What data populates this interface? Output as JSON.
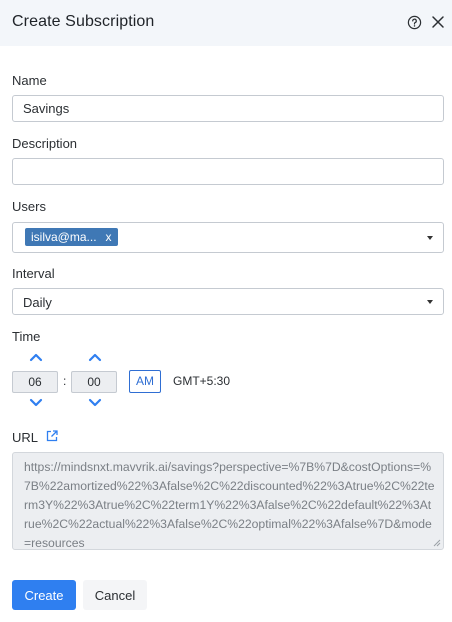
{
  "header": {
    "title": "Create Subscription",
    "help_icon": "help-circle-icon",
    "close_icon": "close-icon"
  },
  "form": {
    "name": {
      "label": "Name",
      "value": "Savings"
    },
    "description": {
      "label": "Description",
      "value": ""
    },
    "users": {
      "label": "Users",
      "chips": [
        "isilva@ma..."
      ],
      "chip_remove": "x"
    },
    "interval": {
      "label": "Interval",
      "value": "Daily"
    },
    "time": {
      "label": "Time",
      "hour": "06",
      "separator": ":",
      "minute": "00",
      "period": "AM",
      "timezone": "GMT+5:30"
    },
    "url": {
      "label": "URL",
      "value": "https://mindsnxt.mavvrik.ai/savings?perspective=%7B%7D&costOptions=%7B%22amortized%22%3Afalse%2C%22discounted%22%3Atrue%2C%22term3Y%22%3Atrue%2C%22term1Y%22%3Afalse%2C%22default%22%3Atrue%2C%22actual%22%3Afalse%2C%22optimal%22%3Afalse%7D&mode=resources"
    }
  },
  "actions": {
    "create": "Create",
    "cancel": "Cancel"
  },
  "colors": {
    "primary": "#2f7ff0",
    "chip": "#3f78b5",
    "header_bg": "#f3f6fa",
    "spinner": "#2f7ff0"
  }
}
